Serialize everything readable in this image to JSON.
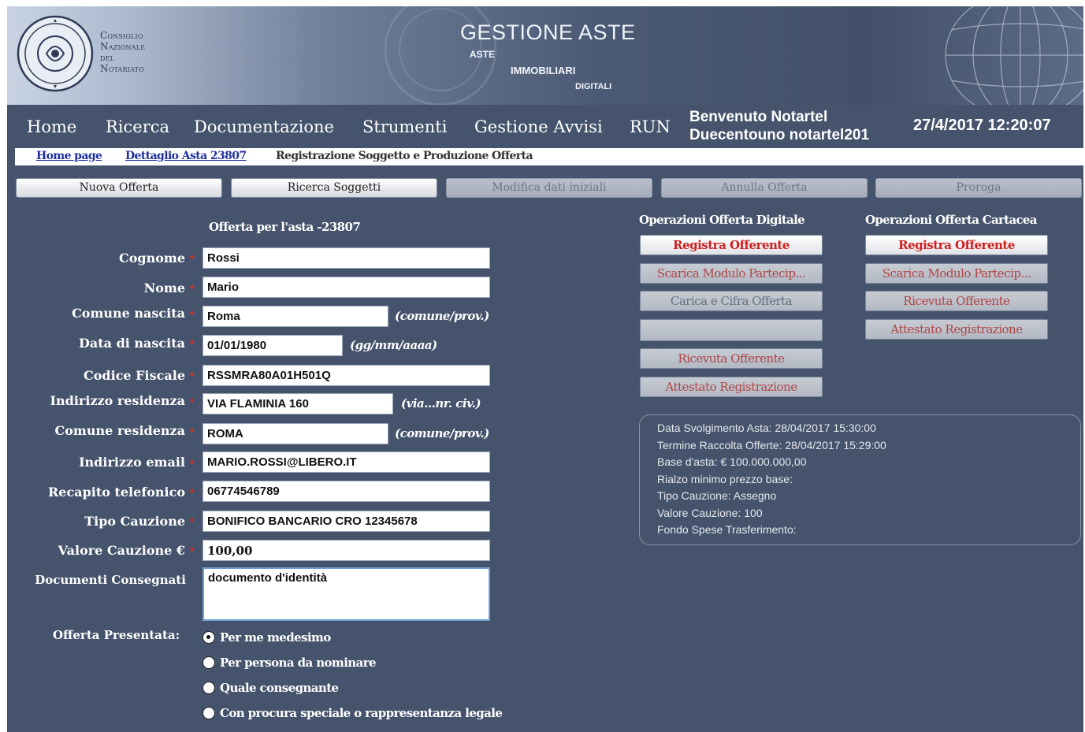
{
  "banner": {
    "org_lines": [
      "Consiglio",
      "Nazionale",
      "del",
      "Notariato"
    ],
    "title": "GESTIONE ASTE",
    "sub1": "ASTE",
    "sub2": "IMMOBILIARI",
    "sub3": "DIGITALI"
  },
  "nav": {
    "items": [
      "Home",
      "Ricerca",
      "Documentazione",
      "Strumenti",
      "Gestione Avvisi",
      "RUN"
    ],
    "welcome_line1": "Benvenuto Notartel",
    "welcome_line2": "Duecentouno notartel201",
    "datetime": "27/4/2017 12:20:07"
  },
  "breadcrumb": {
    "home": "Home page",
    "detail": "Dettaglio Asta 23807",
    "current": "Registrazione Soggetto e Produzione Offerta"
  },
  "actions": [
    "Nuova Offerta",
    "Ricerca Soggetti",
    "Modifica dati iniziali",
    "Annulla Offerta",
    "Proroga"
  ],
  "form": {
    "title": "Offerta per l'asta -23807",
    "required_mark": "*",
    "fields": {
      "cognome": {
        "label": "Cognome",
        "value": "Rossi"
      },
      "nome": {
        "label": "Nome",
        "value": "Mario"
      },
      "comune_nascita": {
        "label": "Comune nascita",
        "value": "Roma",
        "hint": "(comune/prov.)"
      },
      "data_nascita": {
        "label": "Data di nascita",
        "value": "01/01/1980",
        "hint": "(gg/mm/aaaa)"
      },
      "codice_fiscale": {
        "label": "Codice Fiscale",
        "value": "RSSMRA80A01H501Q"
      },
      "indirizzo_residenza": {
        "label": "Indirizzo residenza",
        "value": "VIA FLAMINIA 160",
        "hint": "(via...nr. civ.)"
      },
      "comune_residenza": {
        "label": "Comune residenza",
        "value": "ROMA",
        "hint": "(comune/prov.)"
      },
      "email": {
        "label": "Indirizzo email",
        "value": "MARIO.ROSSI@LIBERO.IT"
      },
      "telefono": {
        "label": "Recapito telefonico",
        "value": "06774546789"
      },
      "tipo_cauzione": {
        "label": "Tipo Cauzione",
        "value": "BONIFICO BANCARIO CRO 12345678"
      },
      "valore_cauzione": {
        "label": "Valore Cauzione €",
        "value": "100,00"
      },
      "documenti": {
        "label": "Documenti Consegnati",
        "value": "documento d'identità"
      }
    },
    "offerta_label": "Offerta Presentata:",
    "radio_options": [
      "Per me medesimo",
      "Per persona da nominare",
      "Quale consegnante",
      "Con procura speciale o rappresentanza legale"
    ],
    "radio_selected": 0
  },
  "ops_digital": {
    "title": "Operazioni Offerta Digitale",
    "buttons": [
      "Registra Offerente",
      "Scarica Modulo Partecip...",
      "Carica e Cifra Offerta",
      "",
      "Ricevuta Offerente",
      "Attestato Registrazione"
    ]
  },
  "ops_paper": {
    "title": "Operazioni Offerta Cartacea",
    "buttons": [
      "Registra Offerente",
      "Scarica Modulo Partecip...",
      "Ricevuta Offerente",
      "Attestato Registrazione"
    ]
  },
  "info": {
    "lines": [
      "Data Svolgimento Asta: 28/04/2017 15:30:00",
      "Termine Raccolta Offerte: 28/04/2017 15:29:00",
      "Base d'asta: € 100.000.000,00",
      "Rialzo minimo prezzo base:",
      "Tipo Cauzione:  Assegno",
      "Valore Cauzione:  100",
      "Fondo Spese Trasferimento:"
    ]
  },
  "colors": {
    "background": "#45536c",
    "required": "#d0322b",
    "active_button_text": "#d11f1f",
    "link": "#1e2f9f"
  }
}
